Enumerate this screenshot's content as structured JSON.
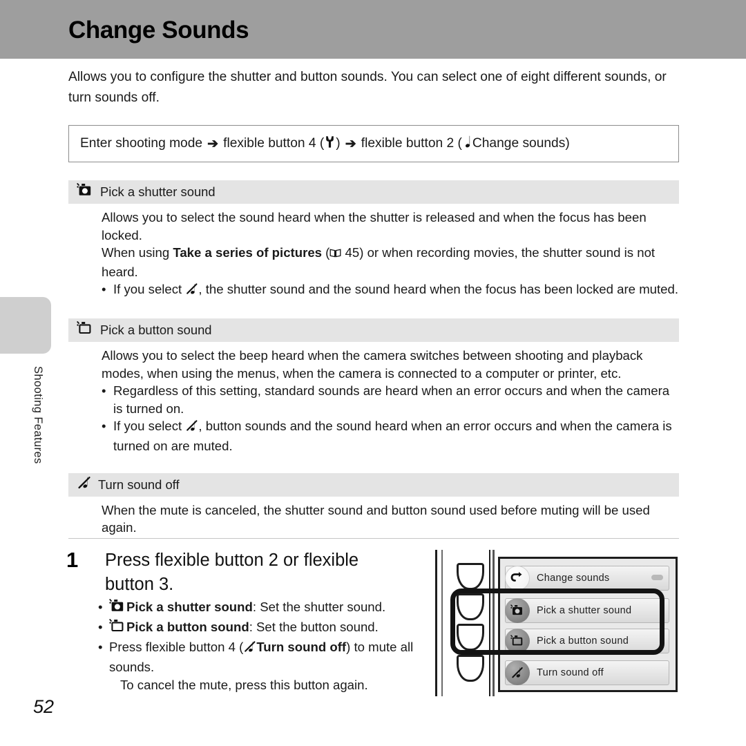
{
  "page": {
    "title": "Change Sounds",
    "number": "52",
    "sidebar_label": "Shooting Features"
  },
  "intro": "Allows you to configure the shutter and button sounds. You can select one of eight different sounds, or turn sounds off.",
  "nav_path": {
    "part1": "Enter shooting mode",
    "arrow": "➔",
    "part2": "flexible button 4 (",
    "wrench_icon": "setup-wrench-icon",
    "part3": ")",
    "part4": "flexible button 2 (",
    "note_icon": "music-note-icon",
    "part5": "Change sounds)"
  },
  "sections": [
    {
      "icon": "shutter-sound-camera-icon",
      "heading": "Pick a shutter sound",
      "para1": "Allows you to select the sound heard when the shutter is released and when the focus has been locked.",
      "para2_pre": "When using ",
      "para2_bold": "Take a series of pictures",
      "para2_mid": " (",
      "para2_book_icon": "book-page-icon",
      "para2_page": " 45) or when recording movies, the shutter sound is not heard.",
      "bullets": [
        {
          "pre": "If you select ",
          "icon": "mute-note-icon",
          "post": ", the shutter sound and the sound heard when the focus has been locked are muted."
        }
      ]
    },
    {
      "icon": "button-sound-camera-icon",
      "heading": "Pick a button sound",
      "para1": "Allows you to select the beep heard when the camera switches between shooting and playback modes, when using the menus, when the camera is connected to a computer or printer, etc.",
      "bullets": [
        {
          "pre": "Regardless of this setting, standard sounds are heard when an error occurs and when the camera is turned on.",
          "icon": "",
          "post": ""
        },
        {
          "pre": "If you select ",
          "icon": "mute-note-icon",
          "post": ", button sounds and the sound heard when an error occurs and when the camera is turned on are muted."
        }
      ]
    },
    {
      "icon": "mute-note-icon",
      "heading": "Turn sound off",
      "para1": "When the mute is canceled, the shutter sound and button sound used before muting will be used again.",
      "bullets": []
    }
  ],
  "step": {
    "number": "1",
    "heading": "Press flexible button 2 or flexible button 3.",
    "bullets": [
      {
        "icon": "shutter-sound-camera-icon",
        "bold": "Pick a shutter sound",
        "rest": ": Set the shutter sound."
      },
      {
        "icon": "button-sound-camera-icon",
        "bold": "Pick a button sound",
        "rest": ": Set the button sound."
      }
    ],
    "bullet3_pre": "Press flexible button 4 (",
    "bullet3_icon": "mute-note-icon",
    "bullet3_bold": "Turn sound off",
    "bullet3_post": ") to mute all sounds.",
    "bullet3_extra": "To cancel the mute, press this button again."
  },
  "camera_screen": {
    "rows": [
      {
        "icon": "back-arrow-icon",
        "label": "Change sounds",
        "highlighted": false
      },
      {
        "icon": "shutter-sound-camera-icon",
        "label": "Pick a shutter sound",
        "highlighted": true
      },
      {
        "icon": "button-sound-camera-icon",
        "label": "Pick a button sound",
        "highlighted": true
      },
      {
        "icon": "mute-note-icon",
        "label": "Turn sound off",
        "highlighted": false
      }
    ]
  },
  "colors": {
    "header_band": "#9e9e9e",
    "section_bar": "#e4e4e4",
    "sidebar_tab": "#cfcfcf"
  }
}
